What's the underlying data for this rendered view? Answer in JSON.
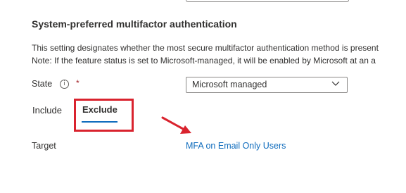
{
  "section": {
    "title": "System-preferred multifactor authentication",
    "description_line1": "This setting designates whether the most secure multifactor authentication method is present",
    "description_line2": "Note: If the feature status is set to Microsoft-managed, it will be enabled by Microsoft at an a"
  },
  "state": {
    "label": "State",
    "info_icon_glyph": "i",
    "required_mark": "*",
    "selected_value": "Microsoft managed"
  },
  "tabs": [
    {
      "label": "Include",
      "selected": false
    },
    {
      "label": "Exclude",
      "selected": true
    }
  ],
  "target": {
    "label": "Target",
    "link_text": "MFA on Email Only Users"
  },
  "colors": {
    "accent": "#0f6cbd",
    "annotation_red": "#d9232e",
    "required_red": "#a4262c"
  },
  "icons": [
    "info-icon",
    "chevron-down-icon",
    "annotation-arrow-icon"
  ]
}
